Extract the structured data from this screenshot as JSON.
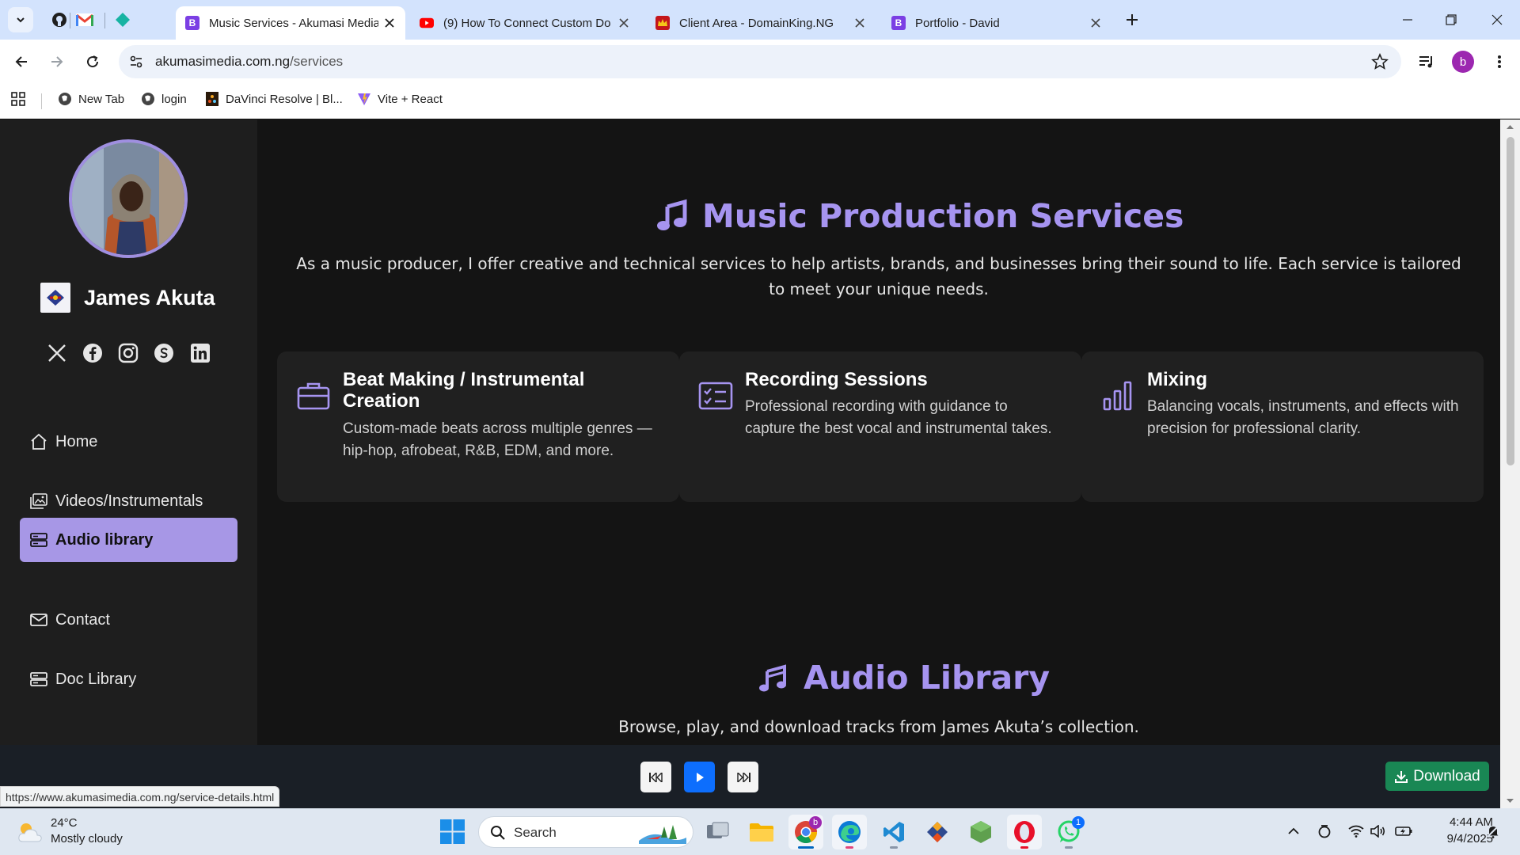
{
  "browser": {
    "tabs": [
      {
        "label": "Music Services - Akumasi Media",
        "favicon": "B",
        "favicon_color": "#7b3fe4",
        "active": true
      },
      {
        "label": "(9) How To Connect Custom Do",
        "favicon": "youtube-icon",
        "favicon_color": "#ff0000",
        "active": false
      },
      {
        "label": "Client Area - DomainKing.NG",
        "favicon": "crown-icon",
        "favicon_color": "#c4161c",
        "active": false
      },
      {
        "label": "Portfolio - David",
        "favicon": "B",
        "favicon_color": "#7b3fe4",
        "active": false
      }
    ],
    "url_host": "akumasimedia.com.ng",
    "url_path": "/services",
    "profile_initial": "b",
    "bookmarks": [
      {
        "label": "New Tab"
      },
      {
        "label": "login"
      },
      {
        "label": "DaVinci Resolve | Bl..."
      },
      {
        "label": "Vite + React"
      }
    ],
    "status_url": "https://www.akumasimedia.com.ng/service-details.html"
  },
  "sidebar": {
    "name": "James Akuta",
    "social": [
      "x-icon",
      "facebook-icon",
      "instagram-icon",
      "skype-icon",
      "linkedin-icon"
    ],
    "nav": [
      {
        "label": "Home",
        "icon": "house-icon"
      },
      {
        "label": "Videos/Instrumentals",
        "icon": "images-icon"
      },
      {
        "label": "Audio library",
        "icon": "server-icon",
        "active": true
      },
      {
        "label": "Contact",
        "icon": "envelope-icon"
      },
      {
        "label": "Doc Library",
        "icon": "server-icon"
      }
    ]
  },
  "services": {
    "title": "Music Production Services",
    "lead": "As a music producer, I offer creative and technical services to help artists, brands, and businesses bring their sound to life. Each service is tailored to meet your unique needs.",
    "cards": [
      {
        "title": "Beat Making / Instrumental Creation",
        "desc": "Custom-made beats across multiple genres — hip-hop, afrobeat, R&B, EDM, and more.",
        "icon": "briefcase-icon"
      },
      {
        "title": "Recording Sessions",
        "desc": "Professional recording with guidance to capture the best vocal and instrumental takes.",
        "icon": "checklist-icon"
      },
      {
        "title": "Mixing",
        "desc": "Balancing vocals, instruments, and effects with precision for professional clarity.",
        "icon": "bar-chart-icon"
      }
    ]
  },
  "audio_library": {
    "title": "Audio Library",
    "subtitle": "Browse, play, and download tracks from James Akuta’s collection."
  },
  "player": {
    "download_label": "Download"
  },
  "taskbar": {
    "weather_temp": "24°C",
    "weather_desc": "Mostly cloudy",
    "search_label": "Search",
    "whatsapp_badge": "1",
    "chrome_badge": "b",
    "time": "4:44 AM",
    "date": "9/4/2025"
  },
  "colors": {
    "accent": "#a694f0",
    "nav_active": "#a797e6",
    "play_button": "#0d6efd",
    "download_button": "#198754"
  }
}
